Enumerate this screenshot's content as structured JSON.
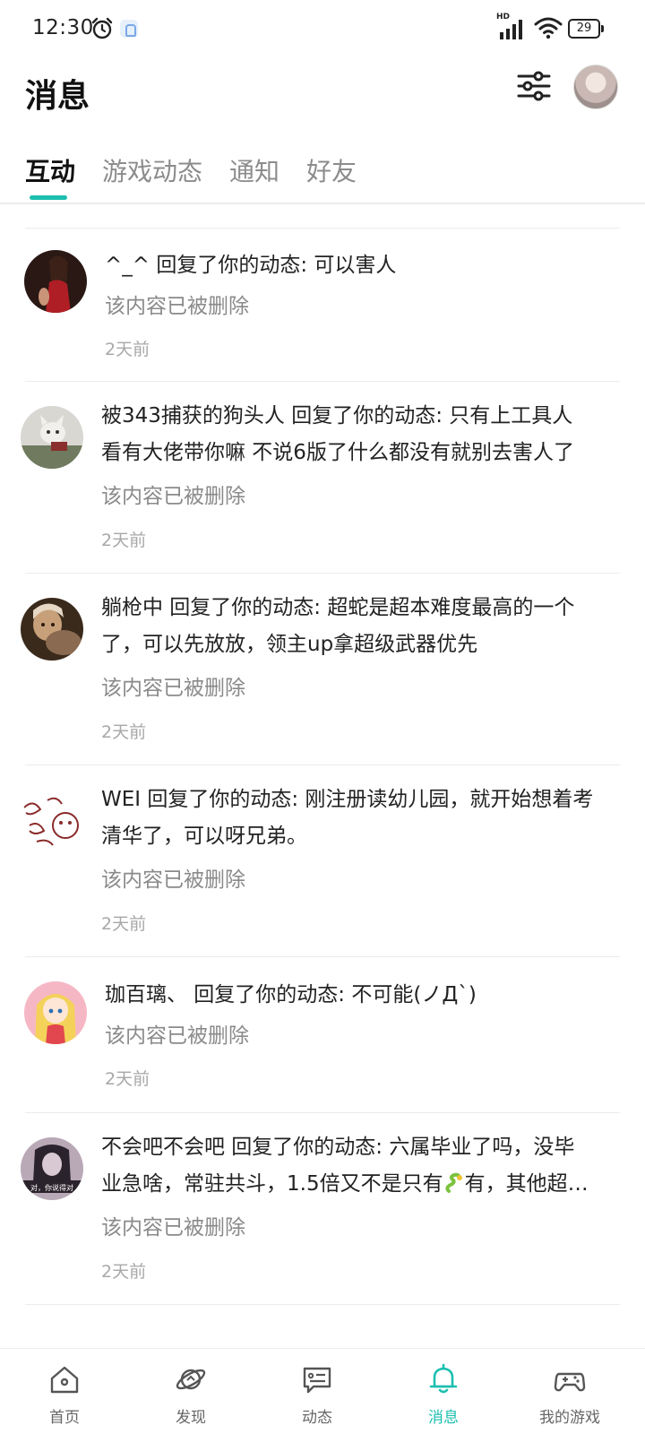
{
  "status_bar": {
    "time": "12:30",
    "battery": "29",
    "network": "HD",
    "icons": [
      "alarm-icon",
      "notification-icon",
      "signal-icon",
      "wifi-icon",
      "battery-icon"
    ]
  },
  "header": {
    "title": "消息",
    "filter_icon": "filter-sliders-icon"
  },
  "tabs": [
    {
      "label": "互动",
      "active": true
    },
    {
      "label": "游戏动态",
      "active": false
    },
    {
      "label": "通知",
      "active": false
    },
    {
      "label": "好友",
      "active": false
    }
  ],
  "messages": [
    {
      "title": "^_^ 回复了你的动态: 可以害人",
      "sub": "该内容已被删除",
      "time": "2天前"
    },
    {
      "title_line1": "被343捕获的狗头人 回复了你的动态: 只有上工具人",
      "title_line2": "看有大佬带你嘛 不说6版了什么都没有就别去害人了",
      "sub": "该内容已被删除",
      "time": "2天前"
    },
    {
      "title_line1": "躺枪中 回复了你的动态: 超蛇是超本难度最高的一个",
      "title_line2": "了，可以先放放，领主up拿超级武器优先",
      "sub": "该内容已被删除",
      "time": "2天前"
    },
    {
      "title_line1": "WEI 回复了你的动态: 刚注册读幼儿园，就开始想着考",
      "title_line2": "清华了，可以呀兄弟。",
      "sub": "该内容已被删除",
      "time": "2天前"
    },
    {
      "title": "珈百璃、 回复了你的动态: 不可能(ノДˋ)",
      "sub": "该内容已被删除",
      "time": "2天前"
    },
    {
      "title_line1": "不会吧不会吧 回复了你的动态: 六属毕业了吗，没毕",
      "title_line2_a": "业急啥，常驻共斗，1.5倍又不是只有",
      "title_line2_b": "有，其他超…",
      "emoji": "snake-emoji",
      "avatar_text": "对，你说得对",
      "sub": "该内容已被删除",
      "time": "2天前"
    }
  ],
  "bottom_nav": [
    {
      "label": "首页",
      "icon": "home-icon",
      "active": false
    },
    {
      "label": "发现",
      "icon": "planet-icon",
      "active": false
    },
    {
      "label": "动态",
      "icon": "feed-icon",
      "active": false
    },
    {
      "label": "消息",
      "icon": "bell-icon",
      "active": true
    },
    {
      "label": "我的游戏",
      "icon": "gamepad-icon",
      "active": false
    }
  ],
  "colors": {
    "accent": "#1cbfb0",
    "text": "#222222",
    "muted": "#8a8a8a",
    "time": "#a8a8a8"
  }
}
